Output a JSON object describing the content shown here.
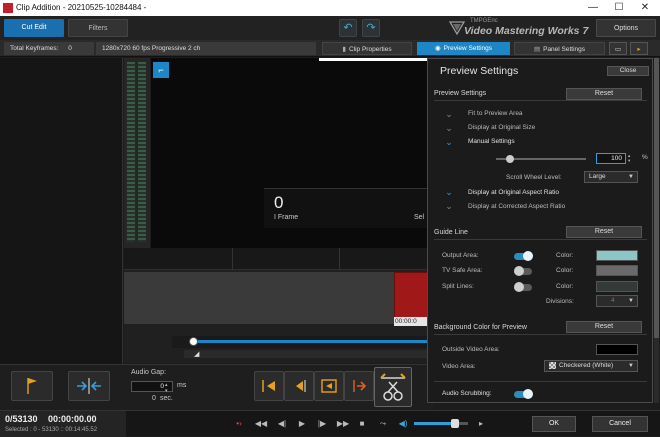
{
  "window": {
    "title": "Clip Addition - 20210525-10284484 -",
    "minimize": "—",
    "maximize": "☐",
    "close": "✕"
  },
  "toolbar": {
    "tab_cut_edit": "Cut Edit",
    "tab_filters": "Filters",
    "brand_top": "TMPGEnc",
    "brand_main": "Video Mastering Works 7",
    "options": "Options"
  },
  "infobar": {
    "keyframes_label": "Total Keyframes:",
    "keyframes_value": "0",
    "video_info": "1280x720 60 fps Progressive 2 ch",
    "clip_properties": "Clip Properties",
    "preview_settings": "Preview Settings",
    "panel_settings": "Panel Settings"
  },
  "preview": {
    "frame_number": "0",
    "frame_type": "I Frame",
    "sel_text": "Sel",
    "timecode": "00:00:0"
  },
  "audio_gap": {
    "label": "Audio Gap:",
    "value": "0",
    "unit_ms": "ms",
    "seconds_value": "0",
    "unit_sec": "sec."
  },
  "footer": {
    "frame_pos": "0/53130",
    "timecode": "00:00:00.00",
    "selected": "Selected : 0 - 53130 :: 00:14:45.52",
    "ok": "OK",
    "cancel": "Cancel"
  },
  "settings_panel": {
    "title": "Preview Settings",
    "close": "Close",
    "preview_section": {
      "label": "Preview Settings",
      "reset": "Reset",
      "options": [
        {
          "label": "Fit to Preview Area",
          "active": false
        },
        {
          "label": "Display at Original Size",
          "active": false
        },
        {
          "label": "Manual Settings",
          "active": true
        }
      ],
      "zoom_value": "100",
      "zoom_unit": "%",
      "scroll_wheel_label": "Scroll Wheel Level:",
      "scroll_wheel_value": "Large",
      "aspect_options": [
        {
          "label": "Display at Original Aspect Ratio",
          "active": true
        },
        {
          "label": "Display at Corrected Aspect Ratio",
          "active": false
        }
      ]
    },
    "guide_line": {
      "label": "Guide Line",
      "reset": "Reset",
      "rows": [
        {
          "label": "Output Area:",
          "on": true,
          "color_label": "Color:",
          "color": "#8cc6c6"
        },
        {
          "label": "TV Safe Area:",
          "on": false,
          "color_label": "Color:",
          "color": "#6a6a6a"
        },
        {
          "label": "Split Lines:",
          "on": false,
          "color_label": "Color:",
          "color": "#333a38"
        }
      ],
      "divisions_label": "Divisions:",
      "divisions_value": "4"
    },
    "background": {
      "label": "Background Color for Preview",
      "reset": "Reset",
      "outside_label": "Outside Video Area:",
      "outside_color": "#000000",
      "video_area_label": "Video Area:",
      "video_area_value": "Checkered (White)"
    },
    "audio_scrubbing": {
      "label": "Audio Scrubbing:",
      "on": true
    }
  },
  "colors": {
    "accent": "#1f86c6",
    "clip_red": "#a01818",
    "active_tab": "#1a6fb0"
  }
}
